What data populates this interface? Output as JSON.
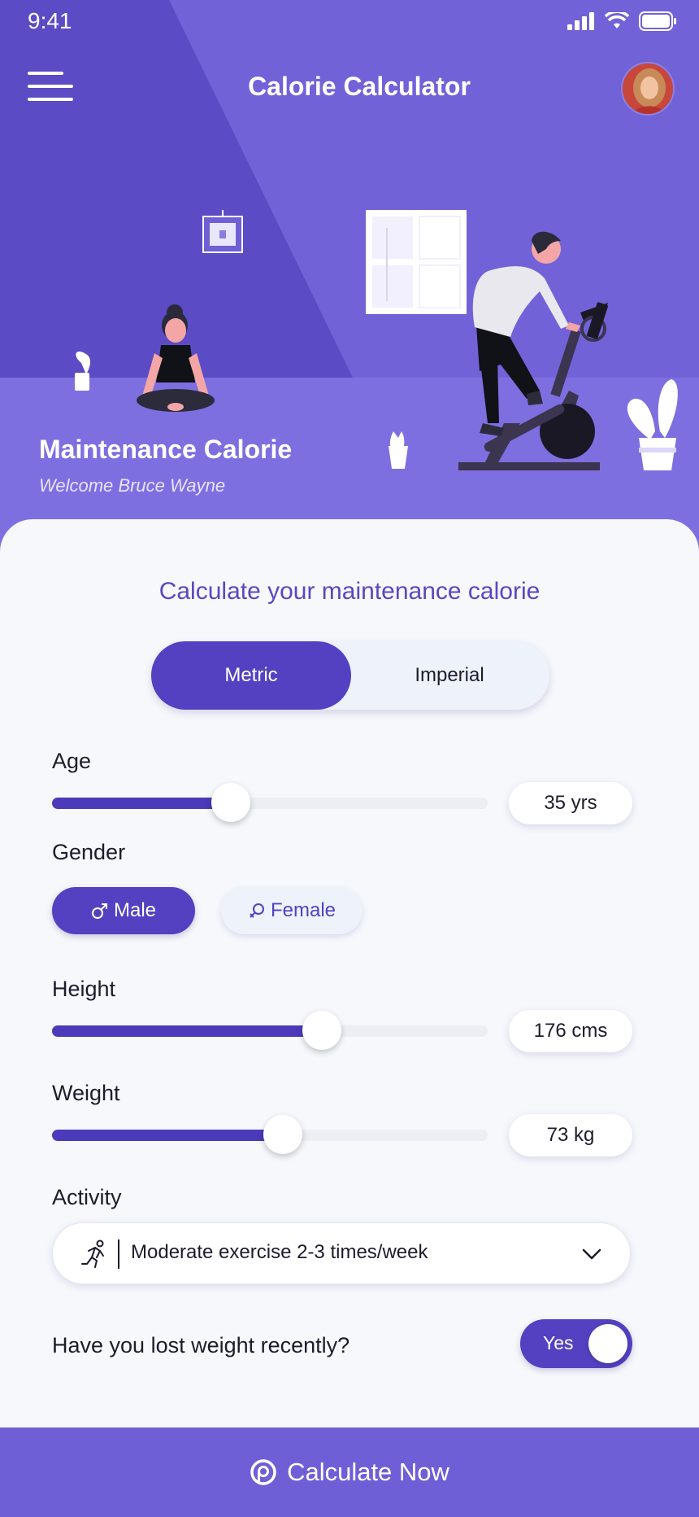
{
  "status_bar": {
    "time": "9:41"
  },
  "header": {
    "title": "Calorie Calculator",
    "menu_icon": "hamburger-menu-icon",
    "avatar": "user-avatar"
  },
  "hero": {
    "title": "Maintenance Calorie",
    "subtitle": "Welcome Bruce Wayne"
  },
  "form": {
    "heading": "Calculate your maintenance calorie",
    "units": {
      "options": [
        "Metric",
        "Imperial"
      ],
      "selected": "Metric"
    },
    "age": {
      "label": "Age",
      "value_text": "35 yrs",
      "level": 0.41
    },
    "gender": {
      "label": "Gender",
      "options": [
        "Male",
        "Female"
      ],
      "selected": "Male"
    },
    "height": {
      "label": "Height",
      "value_text": "176 cms",
      "level": 0.62
    },
    "weight": {
      "label": "Weight",
      "value_text": "73 kg",
      "level": 0.53
    },
    "activity": {
      "label": "Activity",
      "value": "Moderate exercise 2-3 times/week"
    },
    "lost_weight": {
      "label": "Have you lost weight recently?",
      "toggle_text": "Yes",
      "on": true
    }
  },
  "cta": {
    "label": "Calculate Now"
  },
  "colors": {
    "primary": "#5341c2",
    "hero_bg": "#5b4bc4",
    "floor": "#7d6fe0",
    "cta_bg": "#6f5fd6",
    "heading": "#5a47c3"
  }
}
